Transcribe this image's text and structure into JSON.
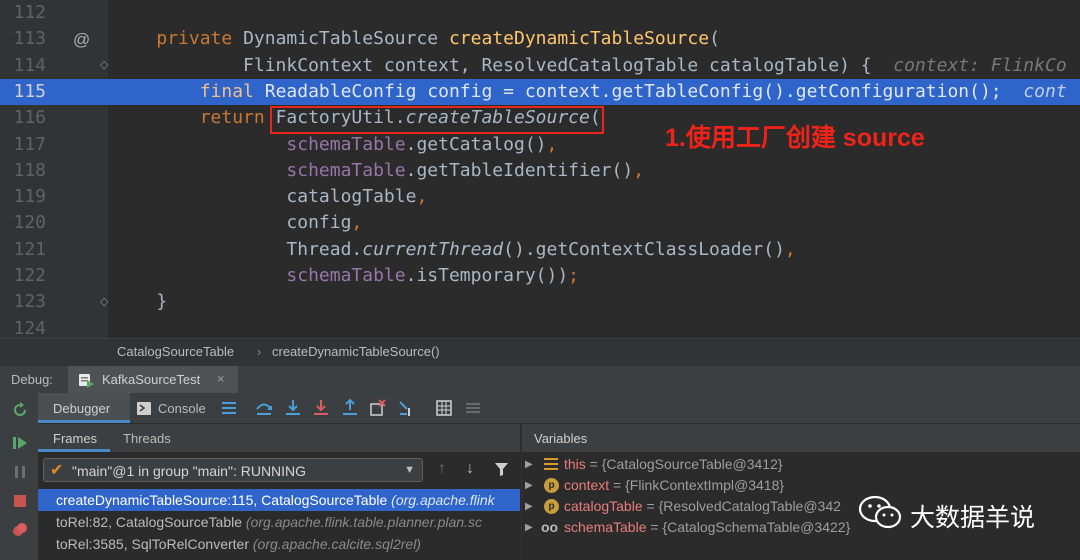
{
  "editor": {
    "lines": [
      {
        "n": "112",
        "tokens": []
      },
      {
        "n": "113",
        "tokens": [
          {
            "t": "    ",
            "c": ""
          },
          {
            "t": "private ",
            "c": "kw"
          },
          {
            "t": "DynamicTableSource ",
            "c": ""
          },
          {
            "t": "createDynamicTableSource",
            "c": "fn"
          },
          {
            "t": "(",
            "c": ""
          }
        ]
      },
      {
        "n": "114",
        "tokens": [
          {
            "t": "            FlinkContext context, ResolvedCatalogTable catalogTable) { ",
            "c": ""
          },
          {
            "t": " context: FlinkCo",
            "c": "hint"
          }
        ]
      },
      {
        "n": "115",
        "tokens": [
          {
            "t": "        ",
            "c": ""
          },
          {
            "t": "final ",
            "c": "kw"
          },
          {
            "t": "ReadableConfig config = context.getTableConfig().getConfiguration();",
            "c": ""
          },
          {
            "t": "  cont",
            "c": "hint"
          }
        ]
      },
      {
        "n": "116",
        "tokens": [
          {
            "t": "        ",
            "c": ""
          },
          {
            "t": "return ",
            "c": "kw"
          },
          {
            "t": "FactoryUtil.",
            "c": ""
          },
          {
            "t": "createTableSource",
            "c": "ital"
          },
          {
            "t": "(",
            "c": ""
          }
        ]
      },
      {
        "n": "117",
        "tokens": [
          {
            "t": "                ",
            "c": ""
          },
          {
            "t": "schemaTable",
            "c": "field"
          },
          {
            "t": ".getCatalog()",
            "c": ""
          },
          {
            "t": ",",
            "c": "kw"
          }
        ]
      },
      {
        "n": "118",
        "tokens": [
          {
            "t": "                ",
            "c": ""
          },
          {
            "t": "schemaTable",
            "c": "field"
          },
          {
            "t": ".getTableIdentifier()",
            "c": ""
          },
          {
            "t": ",",
            "c": "kw"
          }
        ]
      },
      {
        "n": "119",
        "tokens": [
          {
            "t": "                catalogTable",
            "c": ""
          },
          {
            "t": ",",
            "c": "kw"
          }
        ]
      },
      {
        "n": "120",
        "tokens": [
          {
            "t": "                config",
            "c": ""
          },
          {
            "t": ",",
            "c": "kw"
          }
        ]
      },
      {
        "n": "121",
        "tokens": [
          {
            "t": "                Thread.",
            "c": ""
          },
          {
            "t": "currentThread",
            "c": "ital"
          },
          {
            "t": "().getContextClassLoader()",
            "c": ""
          },
          {
            "t": ",",
            "c": "kw"
          }
        ]
      },
      {
        "n": "122",
        "tokens": [
          {
            "t": "                ",
            "c": ""
          },
          {
            "t": "schemaTable",
            "c": "field"
          },
          {
            "t": ".isTemporary())",
            "c": ""
          },
          {
            "t": ";",
            "c": "kw"
          }
        ]
      },
      {
        "n": "123",
        "tokens": [
          {
            "t": "    }",
            "c": ""
          }
        ]
      },
      {
        "n": "124",
        "tokens": []
      }
    ],
    "annotation": "1.使用工厂创建 source",
    "gutter_at": "@"
  },
  "breadcrumb": {
    "items": [
      "CatalogSourceTable",
      "createDynamicTableSource()"
    ],
    "sep": "›"
  },
  "debug": {
    "label": "Debug:",
    "tab_title": "KafkaSourceTest",
    "tab_close": "×",
    "debugger_tab": "Debugger",
    "console_tab": "Console",
    "frames_tab": "Frames",
    "threads_tab": "Threads",
    "thread_selector": "\"main\"@1 in group \"main\": RUNNING",
    "frames": [
      {
        "method": "createDynamicTableSource:115, CatalogSourceTable ",
        "pkg": "(org.apache.flink",
        "selected": true
      },
      {
        "method": "toRel:82, CatalogSourceTable ",
        "pkg": "(org.apache.flink.table.planner.plan.sc",
        "selected": false
      },
      {
        "method": "toRel:3585, SqlToRelConverter ",
        "pkg": "(org.apache.calcite.sql2rel)",
        "selected": false
      }
    ],
    "variables_title": "Variables",
    "variables": [
      {
        "name": "this",
        "value": " = {CatalogSourceTable@3412}",
        "icon": "bars"
      },
      {
        "name": "context",
        "value": " = {FlinkContextImpl@3418}",
        "icon": "p"
      },
      {
        "name": "catalogTable",
        "value": " = {ResolvedCatalogTable@342",
        "icon": "p"
      },
      {
        "name": "schemaTable",
        "value": " = {CatalogSchemaTable@3422}",
        "icon": "oo"
      }
    ]
  },
  "watermark": {
    "text": "大数据羊说"
  },
  "colors": {
    "accent": "#2f65ca",
    "annotation": "#ef2318",
    "keyword": "#cc7832"
  }
}
